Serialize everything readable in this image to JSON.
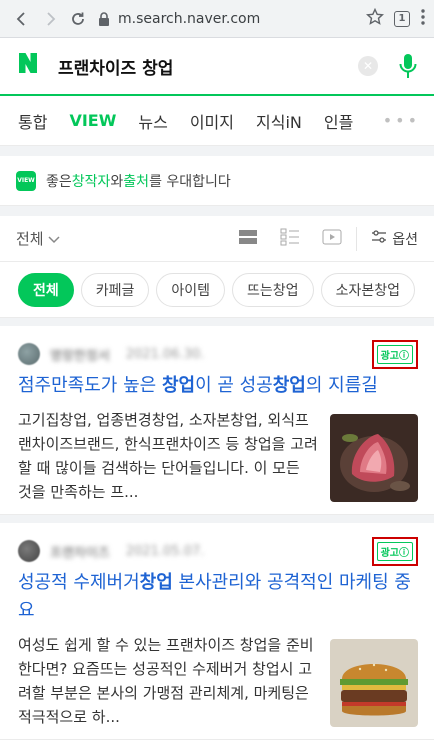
{
  "browser": {
    "url": "m.search.naver.com",
    "tab_count": "1",
    "back_icon": "arrow-left-icon",
    "forward_icon": "arrow-right-icon",
    "reload_icon": "reload-icon",
    "lock_icon": "lock-icon",
    "bookmark_icon": "star-icon",
    "menu_icon": "kebab-menu-icon"
  },
  "search": {
    "logo": "N",
    "query": "프랜차이즈 창업",
    "clear_icon": "close-circle-icon",
    "voice_icon": "microphone-icon",
    "brand_color": "#03c75a"
  },
  "tabs": [
    {
      "label": "통합"
    },
    {
      "label": "VIEW"
    },
    {
      "label": "뉴스"
    },
    {
      "label": "이미지"
    },
    {
      "label": "지식iN"
    },
    {
      "label": "인플"
    }
  ],
  "tabs_more": "•••",
  "notice": {
    "badge": "VIEW",
    "pre": "좋은 ",
    "creator": "창작자",
    "mid": "와 ",
    "source": "출처",
    "post": "를 우대합니다"
  },
  "filter": {
    "sort_label": "전체",
    "option_label": "옵션"
  },
  "chips": [
    {
      "label": "전체"
    },
    {
      "label": "카페글"
    },
    {
      "label": "아이템"
    },
    {
      "label": "뜨는창업"
    },
    {
      "label": "소자본창업"
    }
  ],
  "results": [
    {
      "author": "명랑한정서",
      "date": "2021.06.30.",
      "ad_label": "광고ⓘ",
      "title_parts": [
        "점주만족도가 높은 ",
        "창업",
        "이 곧 성공",
        "창업",
        "의 지름길"
      ],
      "desc": "고기집창업, 업종변경창업, 소자본창업, 외식프랜차이즈브랜드, 한식프랜차이즈 등 창업을 고려할 때 많이들 검색하는 단어들입니다. 이 모든 것을 만족하는 프..."
    },
    {
      "author": "프랜차이즈",
      "date": "2021.05.07.",
      "ad_label": "광고ⓘ",
      "title_parts": [
        "성공적 수제버거",
        "창업",
        " 본사관리와 공격적인 마케팅 중요",
        "",
        ""
      ],
      "desc": "여성도 쉽게 할 수 있는 프랜차이즈 창업을 준비한다면? 요즘뜨는 성공적인 수제버거 창업시 고려할 부분은 본사의 가맹점 관리체계, 마케팅은 적극적으로 하..."
    }
  ]
}
